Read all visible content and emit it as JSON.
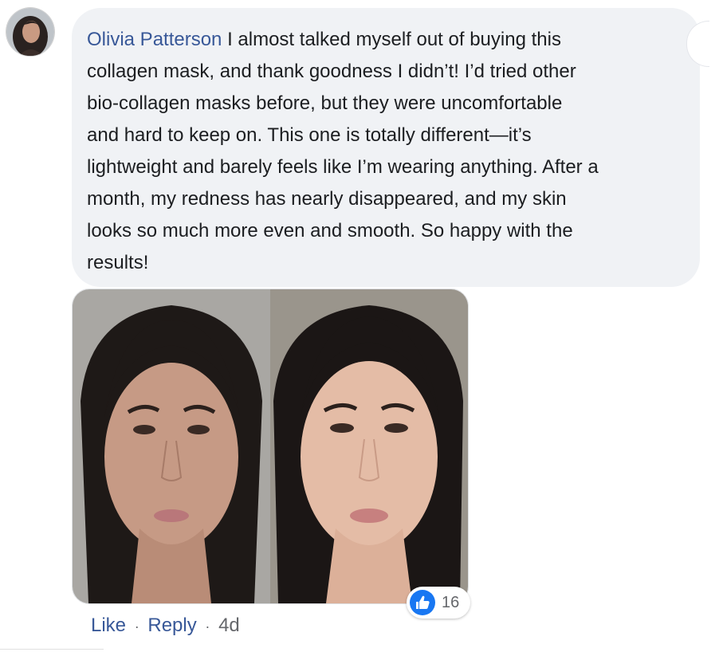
{
  "comment": {
    "author": "Olivia Patterson",
    "text_lines": [
      "I almost talked myself out of buying this",
      "collagen mask, and thank goodness I didn’t! I’d tried other",
      "bio-collagen masks before, but they were uncomfortable",
      "and hard to keep on. This one is totally different—it’s",
      "lightweight and barely feels like I’m wearing anything. After a",
      "month, my redness has nearly disappeared, and my skin",
      "looks so much more even and smooth. So happy with the",
      "results!"
    ]
  },
  "reactions": {
    "icon": "thumbs-up-icon",
    "count": "16"
  },
  "actions": {
    "like": "Like",
    "reply": "Reply",
    "time": "4d",
    "separator": "·"
  },
  "colors": {
    "author_link": "#385898",
    "bubble_bg": "#f0f2f5",
    "like_blue": "#1877f2",
    "meta_gray": "#65676b"
  }
}
